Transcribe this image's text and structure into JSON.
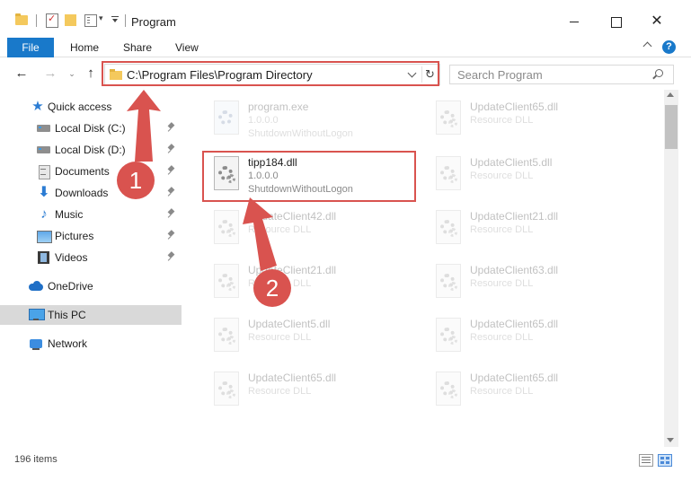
{
  "window": {
    "title": "Program",
    "close_glyph": "✕"
  },
  "ribbon": {
    "tabs": [
      "File",
      "Home",
      "Share",
      "View"
    ],
    "help_glyph": "?"
  },
  "nav": {
    "back_glyph": "←",
    "forward_glyph": "→",
    "recent_glyph": "⌄",
    "up_glyph": "↑",
    "address": "C:\\Program Files\\Program Directory",
    "refresh_glyph": "↻",
    "search_placeholder": "Search Program"
  },
  "sidebar": {
    "items": [
      {
        "label": "Quick access",
        "icon": "star-icon",
        "pinned": false
      },
      {
        "label": "Local Disk (C:)",
        "icon": "disk-icon",
        "pinned": true
      },
      {
        "label": "Local Disk (D:)",
        "icon": "disk-icon",
        "pinned": true
      },
      {
        "label": "Documents",
        "icon": "documents-icon",
        "pinned": true
      },
      {
        "label": "Downloads",
        "icon": "download-icon",
        "pinned": true
      },
      {
        "label": "Music",
        "icon": "music-icon",
        "pinned": true
      },
      {
        "label": "Pictures",
        "icon": "pictures-icon",
        "pinned": true
      },
      {
        "label": "Videos",
        "icon": "videos-icon",
        "pinned": true
      },
      {
        "label": "OneDrive",
        "icon": "onedrive-icon",
        "pinned": false
      },
      {
        "label": "This PC",
        "icon": "this-pc-icon",
        "pinned": false,
        "selected": true
      },
      {
        "label": "Network",
        "icon": "network-icon",
        "pinned": false
      }
    ],
    "glyphs": {
      "star": "★",
      "download": "⬇",
      "music": "♪"
    }
  },
  "files": {
    "left": [
      {
        "name": "program.exe",
        "line2": "1.0.0.0",
        "line3": "ShutdownWithoutLogon",
        "faded": true
      },
      {
        "name": "tipp184.dll",
        "line2": "1.0.0.0",
        "line3": "ShutdownWithoutLogon",
        "faded": false
      },
      {
        "name": "UpdateClient42.dll",
        "line2": "Resource DLL",
        "faded": true
      },
      {
        "name": "UpdateClient21.dll",
        "line2": "Resource DLL",
        "faded": true
      },
      {
        "name": "UpdateClient5.dll",
        "line2": "Resource DLL",
        "faded": true
      },
      {
        "name": "UpdateClient65.dll",
        "line2": "Resource DLL",
        "faded": true
      }
    ],
    "right": [
      {
        "name": "UpdateClient65.dll",
        "line2": "Resource DLL",
        "faded": true
      },
      {
        "name": "UpdateClient5.dll",
        "line2": "Resource DLL",
        "faded": true
      },
      {
        "name": "UpdateClient21.dll",
        "line2": "Resource DLL",
        "faded": true
      },
      {
        "name": "UpdateClient63.dll",
        "line2": "Resource DLL",
        "faded": true
      },
      {
        "name": "UpdateClient65.dll",
        "line2": "Resource DLL",
        "faded": true
      },
      {
        "name": "UpdateClient65.dll",
        "line2": "Resource DLL",
        "faded": true
      }
    ]
  },
  "status": {
    "item_count": "196 items"
  },
  "annotations": {
    "step1": "1",
    "step2": "2",
    "color": "#d9534f"
  }
}
